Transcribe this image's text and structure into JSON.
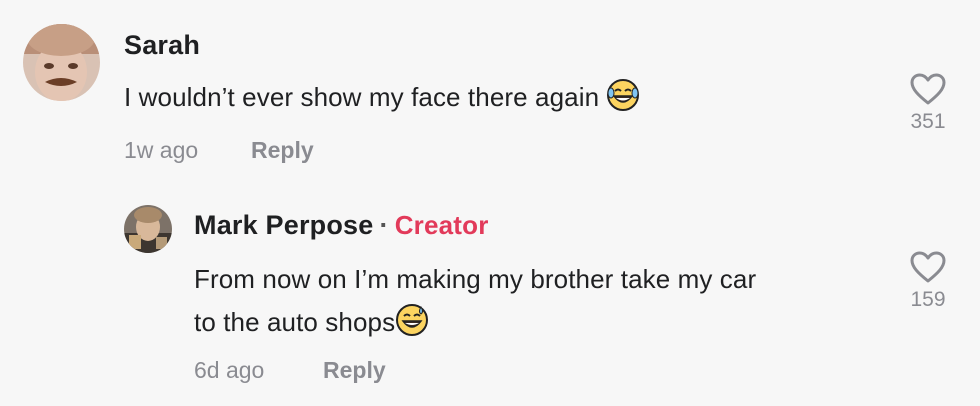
{
  "comments": [
    {
      "username": "Sarah",
      "text": "I wouldn’t ever show my face there again",
      "emoji": "face-with-tears-of-joy-icon",
      "time": "1w ago",
      "reply_label": "Reply",
      "likes": "351"
    },
    {
      "username": "Mark Perpose",
      "separator": "·",
      "badge": "Creator",
      "text_line1": "From now on I’m making my brother take my car",
      "text_line2": "to the auto shops",
      "emoji": "grinning-face-with-sweat-icon",
      "time": "6d ago",
      "reply_label": "Reply",
      "likes": "159"
    }
  ],
  "colors": {
    "background": "#f7f7f7",
    "creator_badge": "#e23a5a",
    "secondary_text": "#8a8b91",
    "primary_text": "#1f2022"
  }
}
